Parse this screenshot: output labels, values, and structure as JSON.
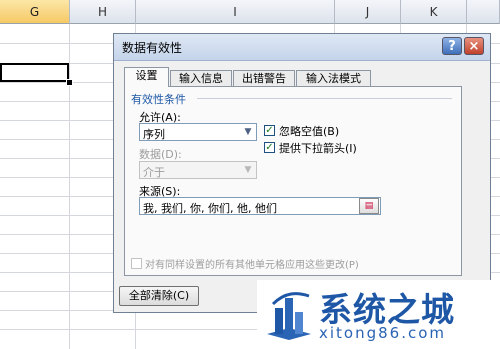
{
  "sheet": {
    "columns": [
      "G",
      "H",
      "I",
      "J",
      "K"
    ],
    "selected_column": "G"
  },
  "dialog": {
    "title": "数据有效性",
    "help_label": "?",
    "close_label": "×",
    "tabs": [
      "设置",
      "输入信息",
      "出错警告",
      "输入法模式"
    ],
    "group_label": "有效性条件",
    "allow_label": "允许(A):",
    "allow_value": "序列",
    "data_label": "数据(D):",
    "data_value": "介于",
    "ignore_blank_label": "忽略空值(B)",
    "ignore_blank_checked": true,
    "dropdown_label": "提供下拉箭头(I)",
    "dropdown_checked": true,
    "source_label": "来源(S):",
    "source_value": "我, 我们, 你, 你们, 他, 他们",
    "apply_all_label": "对有同样设置的所有其他单元格应用这些更改(P)",
    "clear_all_label": "全部清除(C)"
  },
  "watermark": {
    "name": "系统之城",
    "url": "xitong86.com"
  },
  "colors": {
    "accent": "#1d57a6",
    "selected_header": "#f6c965"
  }
}
